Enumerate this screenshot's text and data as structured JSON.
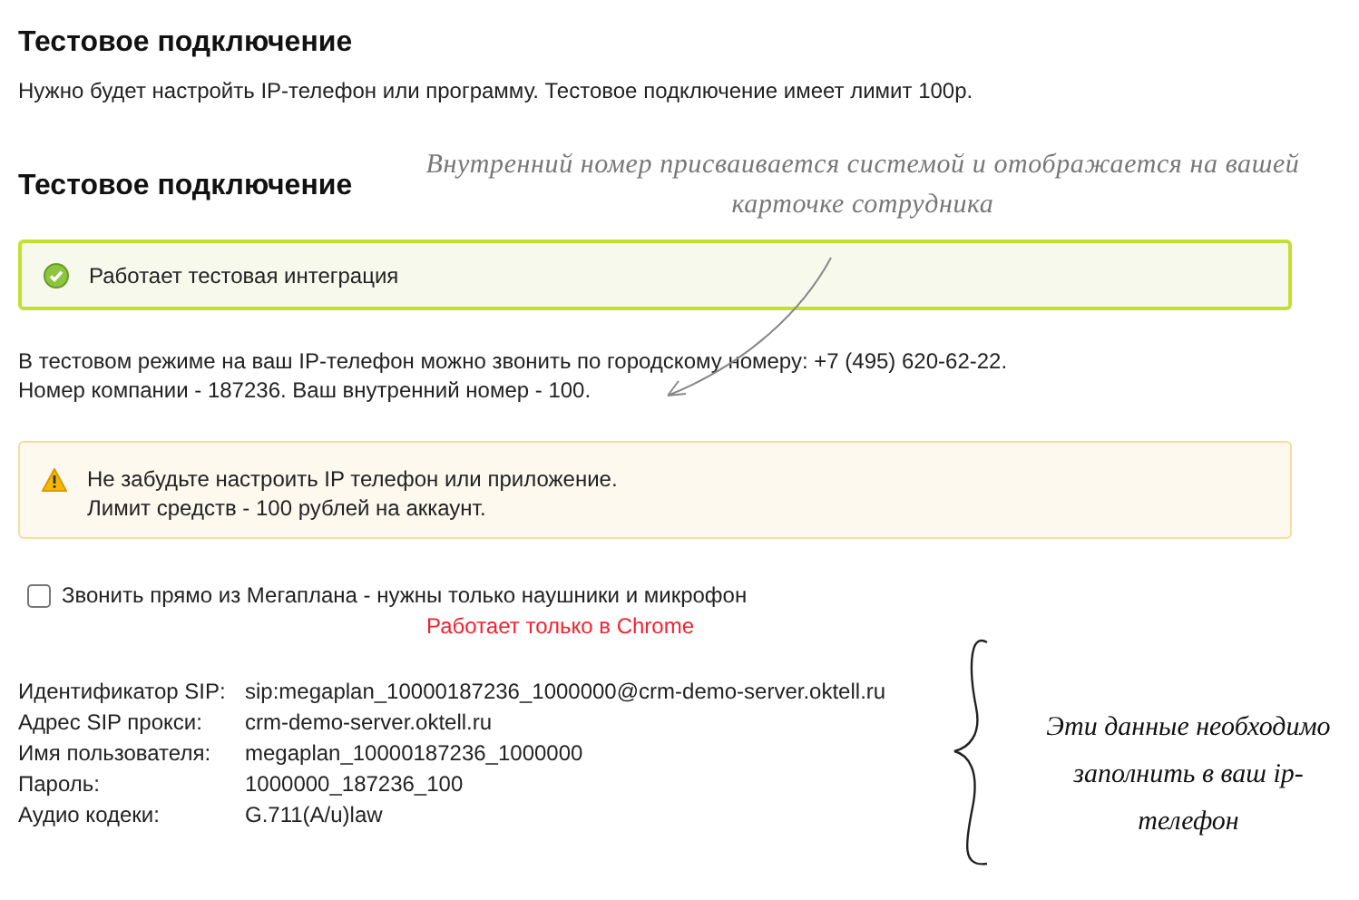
{
  "title": "Тестовое подключение",
  "intro": "Нужно будет настройть IP-телефон или программу. Тестовое подключение имеет лимит 100р.",
  "section_title": "Тестовое подключение",
  "note_top": "Внутренний номер присваивается системой и отображается на вашей карточке сотрудника",
  "status": {
    "kind": "success",
    "text": "Работает тестовая интеграция"
  },
  "info_lines": [
    "В тестовом режиме на ваш IP-телефон можно звонить по городскому номеру: +7 (495) 620-62-22.",
    "Номер компании - 187236. Ваш внутренний номер - 100."
  ],
  "warning": {
    "kind": "warning",
    "lines": [
      "Не забудьте настроить IP телефон или приложение.",
      "Лимит средств - 100 рублей на аккаунт."
    ]
  },
  "browser_call": {
    "label": "Звонить прямо из Мегаплана - нужны только наушники и микрофон",
    "checked": false,
    "hint": "Работает только в Chrome"
  },
  "settings": [
    {
      "label": "Идентификатор SIP:",
      "value": "sip:megaplan_10000187236_1000000@crm-demo-server.oktell.ru"
    },
    {
      "label": "Адрес SIP прокси:",
      "value": "crm-demo-server.oktell.ru"
    },
    {
      "label": "Имя пользователя:",
      "value": "megaplan_10000187236_1000000"
    },
    {
      "label": "Пароль:",
      "value": "1000000_187236_100"
    },
    {
      "label": "Аудио кодеки:",
      "value": "G.711(A/u)law"
    }
  ],
  "note_bottom": "Эти данные необходимо заполнить в ваш ip-телефон"
}
